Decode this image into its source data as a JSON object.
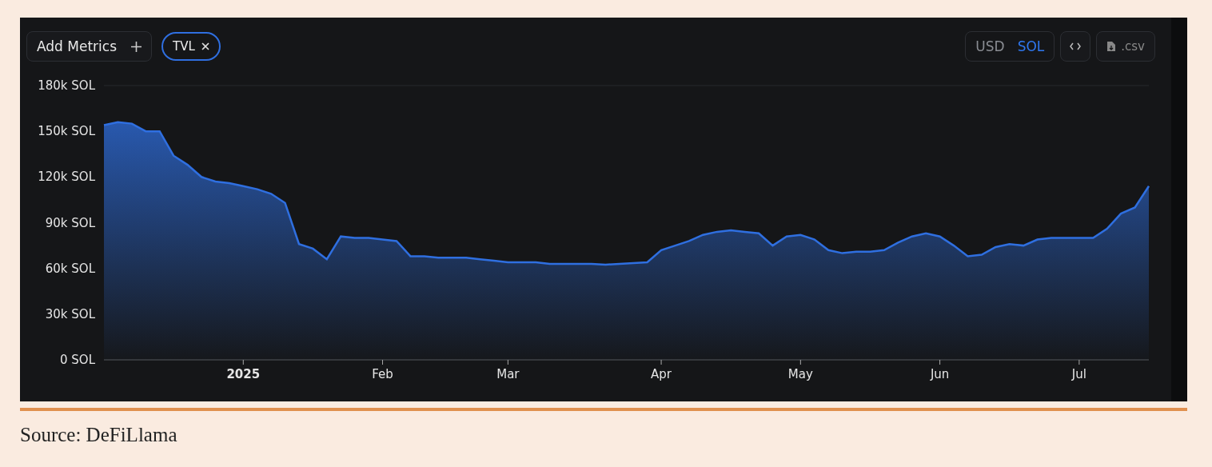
{
  "toolbar": {
    "add_metrics_label": "Add Metrics",
    "currency": [
      {
        "label": "USD",
        "selected": false
      },
      {
        "label": "SOL",
        "selected": true
      }
    ],
    "csv_label": ".csv"
  },
  "chart": {
    "chart_data": {
      "type": "area",
      "ylim": [
        0,
        180000
      ],
      "categories": [
        null,
        null,
        null,
        null,
        null,
        null,
        null,
        null,
        null,
        null,
        "2025",
        null,
        null,
        null,
        null,
        null,
        null,
        null,
        null,
        null,
        "Feb",
        null,
        null,
        null,
        null,
        null,
        null,
        null,
        null,
        "Mar",
        null,
        null,
        null,
        null,
        null,
        null,
        null,
        null,
        null,
        null,
        "Apr",
        null,
        null,
        null,
        null,
        null,
        null,
        null,
        null,
        null,
        "May",
        null,
        null,
        null,
        null,
        null,
        null,
        null,
        null,
        null,
        "Jun",
        null,
        null,
        null,
        null,
        null,
        null,
        null,
        null,
        null,
        "Jul",
        null,
        null,
        null,
        null,
        null
      ],
      "yticks": [
        {
          "value": 0,
          "label": "0 SOL"
        },
        {
          "value": 30000,
          "label": "30k SOL"
        },
        {
          "value": 60000,
          "label": "60k SOL"
        },
        {
          "value": 90000,
          "label": "90k SOL"
        },
        {
          "value": 120000,
          "label": "120k SOL"
        },
        {
          "value": 150000,
          "label": "150k SOL"
        },
        {
          "value": 180000,
          "label": "180k SOL"
        }
      ],
      "series": [
        {
          "name": "TVL",
          "color": "#2f6fe0",
          "values": [
            154000,
            156000,
            155000,
            150000,
            150000,
            134000,
            128000,
            120000,
            117000,
            116000,
            114000,
            112000,
            109000,
            103000,
            76000,
            73000,
            66000,
            81000,
            80000,
            80000,
            79000,
            78000,
            68000,
            68000,
            67000,
            67000,
            67000,
            66000,
            65000,
            64000,
            64000,
            64000,
            63000,
            63000,
            63000,
            63000,
            62500,
            63000,
            63500,
            64000,
            72000,
            75000,
            78000,
            82000,
            84000,
            85000,
            84000,
            83000,
            75000,
            81000,
            82000,
            79000,
            72000,
            70000,
            71000,
            71000,
            72000,
            77000,
            81000,
            83000,
            81000,
            75000,
            68000,
            69000,
            74000,
            76000,
            75000,
            79000,
            80000,
            80000,
            80000,
            80000,
            86000,
            96000,
            100000,
            114000
          ]
        }
      ]
    }
  },
  "source": "Source: DeFiLlama"
}
